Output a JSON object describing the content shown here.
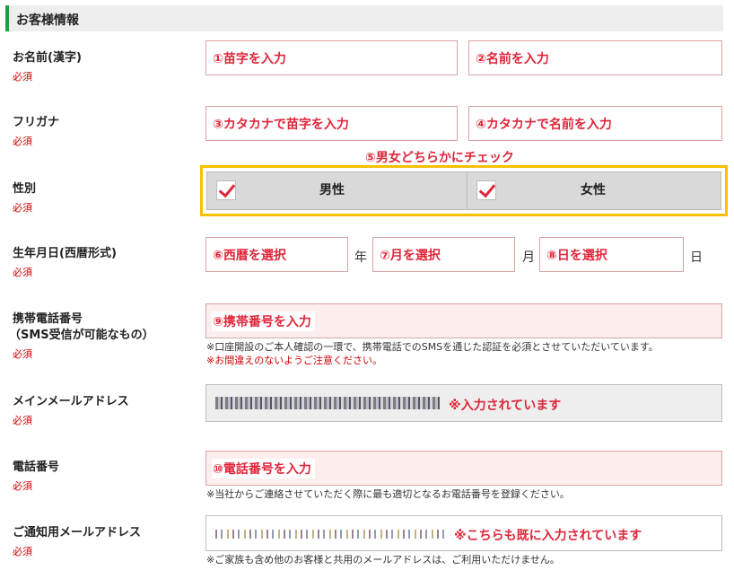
{
  "section": {
    "title": "お客様情報"
  },
  "required": "必須",
  "rows": {
    "name_kanji": {
      "label": "お名前(漢字)",
      "last_ph": "①苗字を入力",
      "first_ph": "②名前を入力"
    },
    "furigana": {
      "label": "フリガナ",
      "last_ph": "③カタカナで苗字を入力",
      "first_ph": "④カタカナで名前を入力"
    },
    "gender": {
      "label": "性別",
      "hint": "⑤男女どちらかにチェック",
      "male": "男性",
      "female": "女性"
    },
    "birthdate": {
      "label": "生年月日(西暦形式)",
      "year_ph": "⑥西暦を選択",
      "year_unit": "年",
      "month_ph": "⑦月を選択",
      "month_unit": "月",
      "day_ph": "⑧日を選択",
      "day_unit": "日"
    },
    "mobile": {
      "label_line1": "携帯電話番号",
      "label_line2": "（SMS受信が可能なもの）",
      "ph": "⑨携帯番号を入力",
      "help": "※口座開設のご本人確認の一環で、携帯電話でのSMSを通じた認証を必須とさせていただいています。",
      "help_red": "※お間違えのないようご注意ください。"
    },
    "main_email": {
      "label": "メインメールアドレス",
      "note": "※入力されています"
    },
    "phone": {
      "label": "電話番号",
      "ph": "⑩電話番号を入力",
      "help": "※当社からご連絡させていただく際に最も適切となるお電話番号を登録ください。"
    },
    "notify_email": {
      "label": "ご通知用メールアドレス",
      "note": "※こちらも既に入力されています",
      "help": "※ご家族も含め他のお客様と共用のメールアドレスは、ご利用いただけません。"
    }
  }
}
